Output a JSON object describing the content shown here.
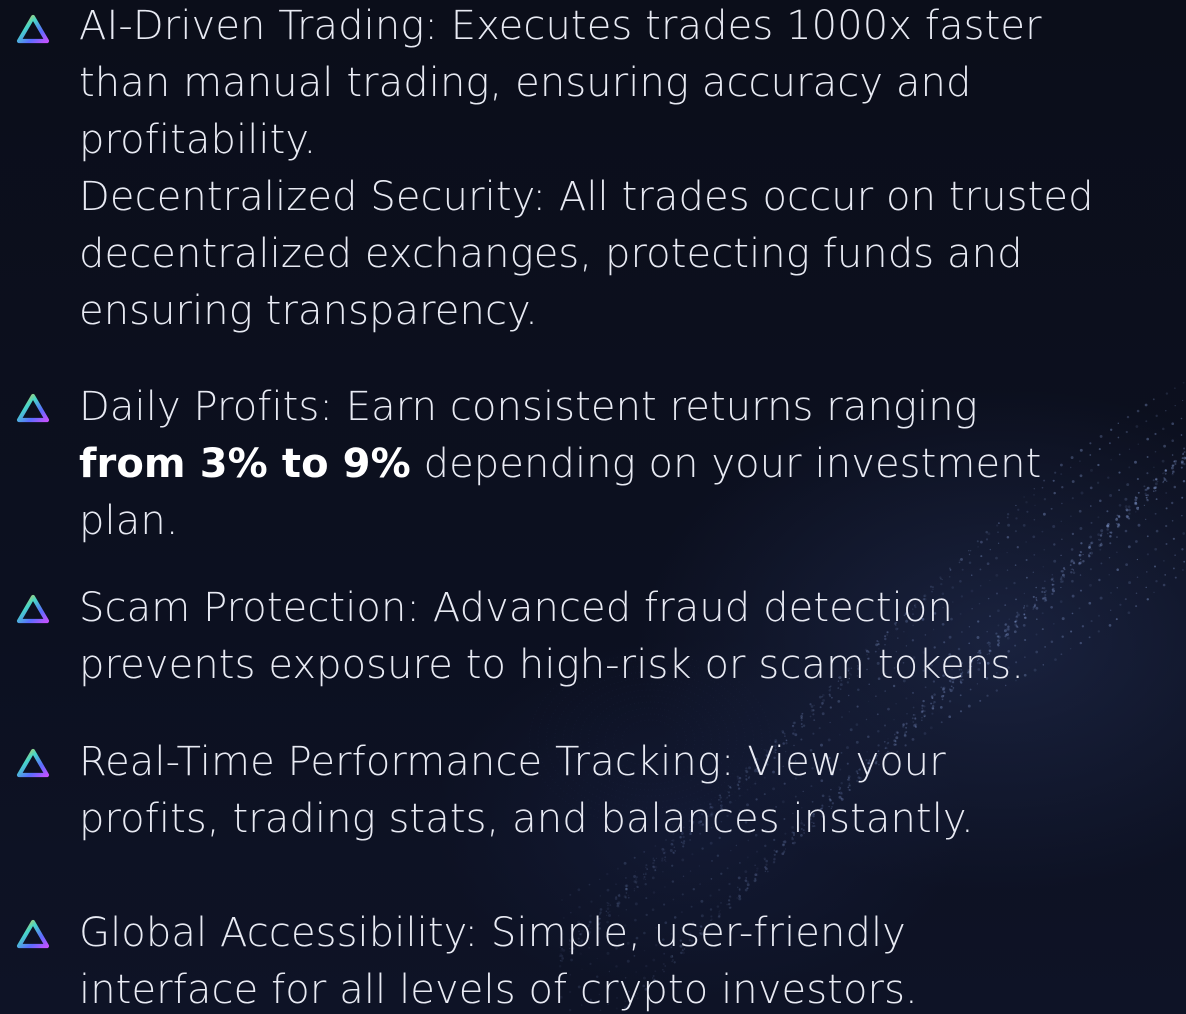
{
  "items": [
    {
      "icon": "triangle-gradient-icon",
      "lines": [
        "AI-Driven Trading: Executes trades 1000x faster",
        "than manual trading, ensuring accuracy and",
        "profitability.",
        "Decentralized Security: All trades occur on trusted",
        "decentralized exchanges, protecting funds and",
        "ensuring transparency."
      ]
    },
    {
      "icon": "triangle-gradient-icon",
      "line1": "Daily Profits: Earn consistent returns ranging",
      "bold": "from 3% to 9%",
      "line2_rest": " depending on your investment",
      "line3": "plan."
    },
    {
      "icon": "triangle-gradient-icon",
      "lines": [
        "Scam Protection: Advanced fraud detection",
        "prevents exposure to high-risk or scam tokens."
      ]
    },
    {
      "icon": "triangle-gradient-icon",
      "lines": [
        "Real-Time Performance Tracking: View your",
        "profits, trading stats, and balances instantly."
      ]
    },
    {
      "icon": "triangle-gradient-icon",
      "lines": [
        "Global Accessibility: Simple, user-friendly",
        "interface for all levels of crypto investors."
      ]
    }
  ],
  "colors": {
    "background": "#0b0e19",
    "text": "#e8eaf3",
    "icon_gradient": [
      "#f5c83a",
      "#46d7c8",
      "#5b6cff",
      "#c052ff"
    ]
  }
}
